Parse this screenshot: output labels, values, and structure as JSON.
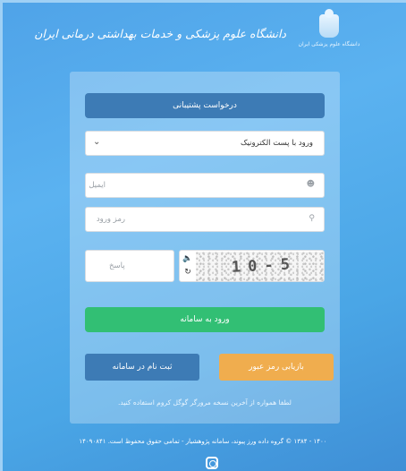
{
  "header": {
    "university_title": "دانشگاه علوم پزشکی و خدمات بهداشتی درمانی ایران",
    "logo_caption": "دانشگاه علوم پزشکی ایران"
  },
  "form": {
    "support_label": "درخواست پشتیبانی",
    "login_method": "ورود با پست الکترونیک",
    "email_placeholder": "ایمیل",
    "password_placeholder": "رمز ورود",
    "answer_placeholder": "پاسخ",
    "captcha_text": "10-5",
    "login_label": "ورود به سامانه",
    "register_label": "ثبت نام در سامانه",
    "recover_label": "بازیابی رمز عبور",
    "notice": "لطفا همواره از آخرین نسخه مرورگر گوگل کروم استفاده کنید."
  },
  "footer": {
    "text": "۱۴۰۰ - ۱۳۸۴ © گروه داده ورز پیوند، سامانه پژوهشیار - تمامی حقوق محفوظ است. ۱۴۰۹۰۸۴۱"
  },
  "icons": {
    "chevron": "chevron-down-icon",
    "user": "user-icon",
    "key": "key-icon",
    "sound": "sound-icon",
    "refresh": "refresh-icon",
    "instagram": "instagram-icon"
  },
  "colors": {
    "support_button": "#3d7bb5",
    "login_button": "#32bf74",
    "recover_button": "#f0ad4e",
    "background": "#4fa3e8"
  }
}
